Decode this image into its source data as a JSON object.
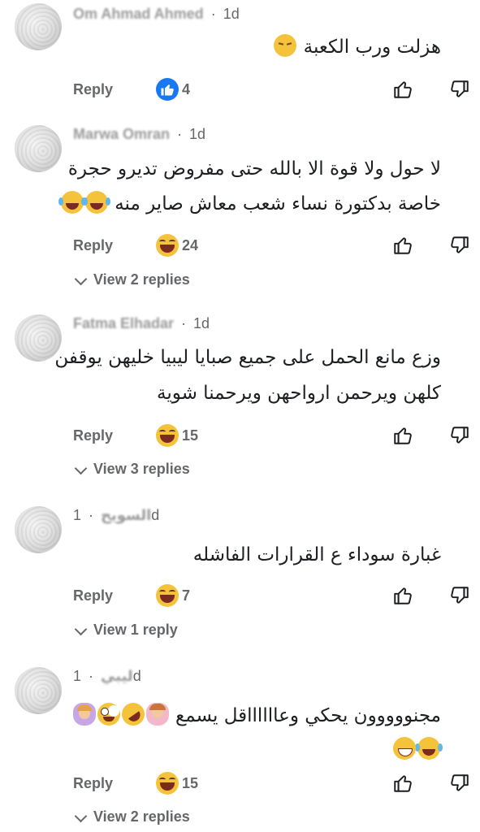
{
  "reply_label": "Reply",
  "comments": [
    {
      "author": "Om Ahmad Ahmed",
      "time": "1d",
      "lines": [
        "هزلت ورب الكعبة"
      ],
      "reaction": "like",
      "count": "4",
      "view_replies": ""
    },
    {
      "author": "Marwa Omran",
      "time": "1d",
      "lines": [
        "لا حول ولا قوة الا بالله حتى مفروض تديرو حجرة",
        "خاصة بدكتورة نساء شعب معاش صاير منه"
      ],
      "reaction": "haha",
      "count": "24",
      "view_replies": "View 2 replies"
    },
    {
      "author": "Fatma Elhadar",
      "time": "1d",
      "lines": [
        "وزع مانع الحمل على جميع صبايا ليبيا خليهن يوقفن",
        "كلهن ويرحمن ارواحهن ويرحمنا شوية"
      ],
      "reaction": "haha",
      "count": "15",
      "view_replies": "View 3 replies"
    },
    {
      "author": "السويح",
      "time": "1d",
      "lines": [
        "غبارة سوداء ع القرارات الفاشله"
      ],
      "reaction": "haha",
      "count": "7",
      "view_replies": "View 1 reply"
    },
    {
      "author": "ليبي",
      "time": "1d",
      "lines": [
        "مجنووووون يحكي وعااااااقل يسمع",
        ""
      ],
      "reaction": "haha",
      "count": "15",
      "view_replies": "View 2 replies"
    }
  ],
  "icons": {
    "like": "thumbs-up-icon",
    "dislike": "thumbs-down-icon",
    "chevron": "chevron-down-icon",
    "like_reaction": "like-reaction-icon",
    "haha_reaction": "haha-reaction-icon"
  },
  "colors": {
    "meta": "#65676b",
    "text": "#1c1e21",
    "like_blue": "#1877f2",
    "emoji_yellow": "#f5c33b"
  }
}
